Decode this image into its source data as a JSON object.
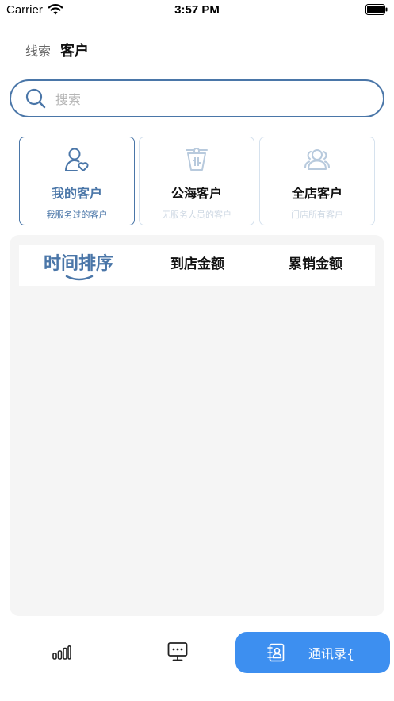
{
  "status_bar": {
    "carrier": "Carrier",
    "time": "3:57 PM"
  },
  "top_tabs": [
    {
      "label": "线索",
      "active": false
    },
    {
      "label": "客户",
      "active": true
    }
  ],
  "search": {
    "placeholder": "搜索"
  },
  "categories": [
    {
      "title": "我的客户",
      "subtitle": "我服务过的客户",
      "icon": "user-heart-icon",
      "active": true
    },
    {
      "title": "公海客户",
      "subtitle": "无服务人员的客户",
      "icon": "sea-pool-icon",
      "active": false
    },
    {
      "title": "全店客户",
      "subtitle": "门店所有客户",
      "icon": "users-group-icon",
      "active": false
    }
  ],
  "sort_tabs": [
    {
      "label": "时间排序",
      "active": true
    },
    {
      "label": "到店金额",
      "active": false
    },
    {
      "label": "累销金额",
      "active": false
    }
  ],
  "bottom_nav": {
    "stats_icon": "bar-chart-icon",
    "monitor_icon": "monitor-icon",
    "contacts_label": "通讯录{",
    "contacts_icon": "address-book-icon"
  },
  "colors": {
    "accent": "#4a76a8",
    "primary_button": "#3d8ff0",
    "panel_bg": "#f5f5f5"
  }
}
